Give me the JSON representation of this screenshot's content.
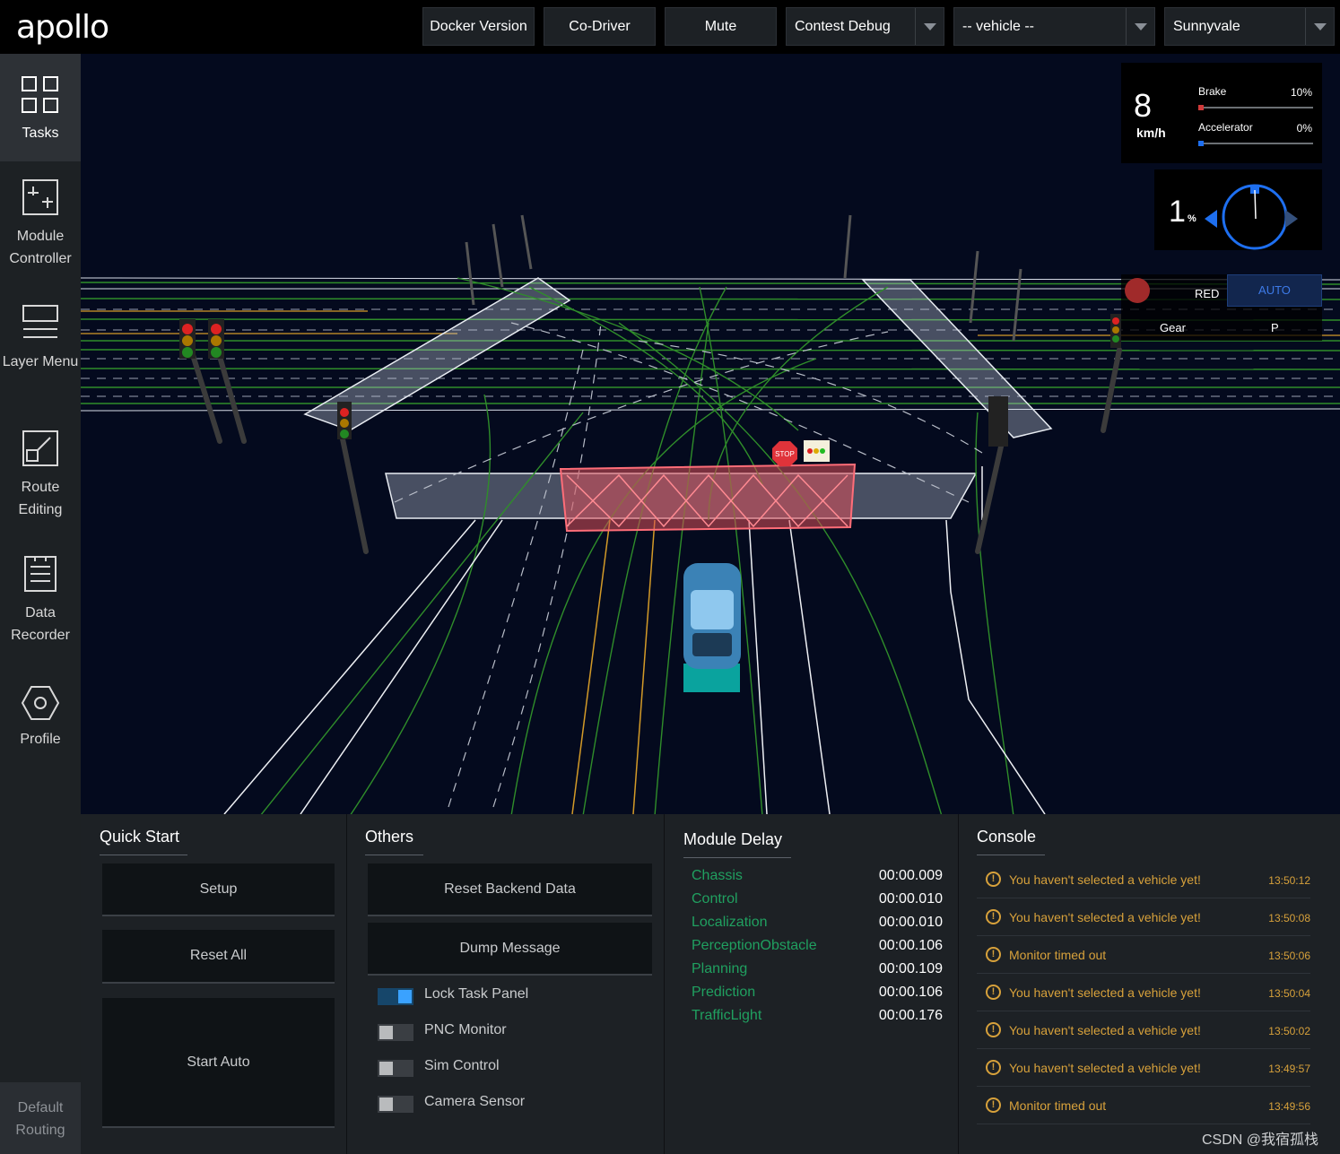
{
  "header": {
    "logo": "apollo",
    "buttons": [
      "Docker Version",
      "Co-Driver",
      "Mute"
    ],
    "mode_select": "Contest Debug",
    "vehicle_select": "-- vehicle --",
    "map_select": "Sunnyvale"
  },
  "sidenav": {
    "items": [
      {
        "label": "Tasks",
        "icon": "grid-icon"
      },
      {
        "label": "Module Controller",
        "icon": "sliders-icon"
      },
      {
        "label": "Layer Menu",
        "icon": "layers-icon"
      },
      {
        "label": "Route Editing",
        "icon": "route-icon"
      },
      {
        "label": "Data Recorder",
        "icon": "document-icon"
      },
      {
        "label": "Profile",
        "icon": "hexagon-icon"
      }
    ],
    "default_routing": "Default Routing"
  },
  "dashboard": {
    "speed": "8",
    "speed_unit": "km/h",
    "brake_label": "Brake",
    "brake_value": "10%",
    "brake_fraction": 0.1,
    "accelerator_label": "Accelerator",
    "accelerator_value": "0%",
    "accelerator_fraction": 0,
    "steering": "1",
    "steering_unit": "%",
    "traffic_light": "RED",
    "drive_mode": "AUTO",
    "gear_label": "Gear",
    "gear_value": "P",
    "colors": {
      "brake": "#d03a3a",
      "accelerator": "#1e6ff0",
      "red_light": "#a02a2a",
      "auto": "#3d7ae8"
    }
  },
  "scene": {
    "stop_sign": "STOP"
  },
  "quick_start": {
    "title": "Quick Start",
    "buttons": [
      "Setup",
      "Reset All",
      "Start Auto"
    ]
  },
  "others": {
    "title": "Others",
    "buttons": [
      "Reset Backend Data",
      "Dump Message"
    ],
    "toggles": [
      {
        "label": "Lock Task Panel",
        "on": true
      },
      {
        "label": "PNC Monitor",
        "on": false
      },
      {
        "label": "Sim Control",
        "on": false
      },
      {
        "label": "Camera Sensor",
        "on": false
      }
    ]
  },
  "module_delay": {
    "title": "Module Delay",
    "rows": [
      {
        "name": "Chassis",
        "value": "00:00.009"
      },
      {
        "name": "Control",
        "value": "00:00.010"
      },
      {
        "name": "Localization",
        "value": "00:00.010"
      },
      {
        "name": "PerceptionObstacle",
        "value": "00:00.106"
      },
      {
        "name": "Planning",
        "value": "00:00.109"
      },
      {
        "name": "Prediction",
        "value": "00:00.106"
      },
      {
        "name": "TrafficLight",
        "value": "00:00.176"
      }
    ]
  },
  "console": {
    "title": "Console",
    "logs": [
      {
        "msg": "You haven't selected a vehicle yet!",
        "time": "13:50:12"
      },
      {
        "msg": "You haven't selected a vehicle yet!",
        "time": "13:50:08"
      },
      {
        "msg": "Monitor timed out",
        "time": "13:50:06"
      },
      {
        "msg": "You haven't selected a vehicle yet!",
        "time": "13:50:04"
      },
      {
        "msg": "You haven't selected a vehicle yet!",
        "time": "13:50:02"
      },
      {
        "msg": "You haven't selected a vehicle yet!",
        "time": "13:49:57"
      },
      {
        "msg": "Monitor timed out",
        "time": "13:49:56"
      }
    ]
  },
  "watermark": "CSDN @我宿孤栈"
}
